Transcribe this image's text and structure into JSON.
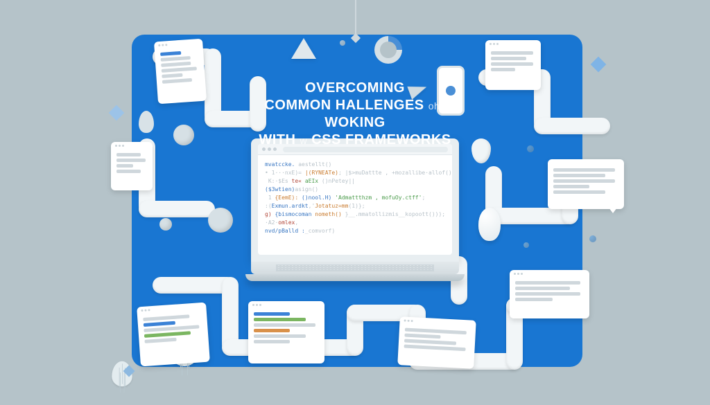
{
  "title": {
    "line1": "OVERCOMING",
    "line2_a": "COMMON HALLENGES",
    "line2_b": "ohd",
    "line2_c": "WOKING",
    "line3_a": "WITH",
    "line3_b": "w",
    "line3_css": "CSS",
    "line3_c": "FRAMEWORKS"
  },
  "code": {
    "l1a": "mvatccke.",
    "l1b": "aestellt()",
    "l2a": "• 1···nxE)=",
    "l2b": "|(RYNEATe)",
    "l2c": "; |$>muDattte , +mozallibe·allof()",
    "l3a": " K:·$Es",
    "l3b": "te«",
    "l3c": "aEIx",
    "l3d": "()nPetey||",
    "l4a": "($3wtien)",
    "l4b": "asign() ",
    "l5a": " 1",
    "l5b": "{EemE):",
    "l5c": "()nool.H)",
    "l5d": "'Admattthzm , mofuOy.ctff'",
    "l5e": ";",
    "l6a": ":(",
    "l6b": "Exmun.ardkt",
    "l6c": ",'",
    "l6d": "Jotatuz=mm",
    "l6e": "(1)};",
    "l7a": "g)",
    "l7b": " {bismocoman",
    "l7c": "nometh()",
    "l7d": " }__.mmatollizmis__kopoott()));",
    "l8a": "·A2·",
    "l8b": "omlex",
    "l8c": ",",
    "l9a": "nvd/pBalld :",
    "l9b": "_comvorf)"
  }
}
